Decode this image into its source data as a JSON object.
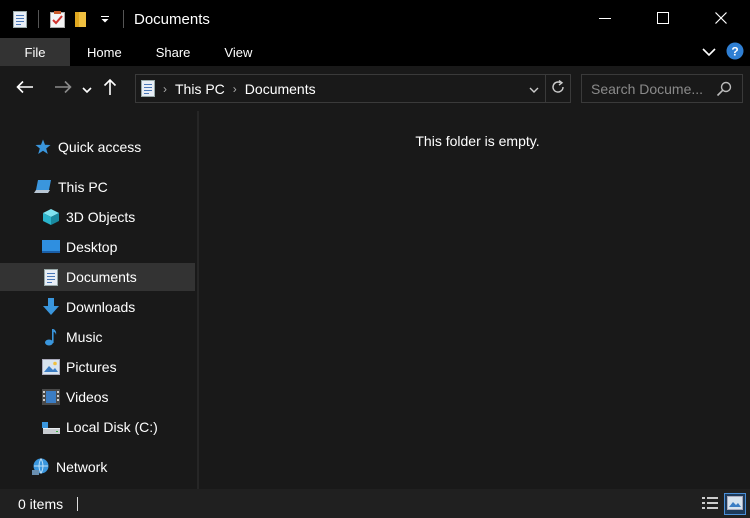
{
  "window": {
    "title": "Documents",
    "minimize_icon": "minimize-icon",
    "maximize_icon": "maximize-icon",
    "close_icon": "close-icon"
  },
  "ribbon": {
    "tabs": [
      {
        "label": "File"
      },
      {
        "label": "Home"
      },
      {
        "label": "Share"
      },
      {
        "label": "View"
      }
    ]
  },
  "address": {
    "segments": [
      "This PC",
      "Documents"
    ]
  },
  "search": {
    "placeholder": "Search Docume..."
  },
  "navpane": {
    "items": [
      {
        "label": "Quick access",
        "icon": "star-icon"
      },
      {
        "label": "This PC",
        "icon": "computer-icon"
      },
      {
        "label": "3D Objects",
        "icon": "cube-icon"
      },
      {
        "label": "Desktop",
        "icon": "desktop-icon"
      },
      {
        "label": "Documents",
        "icon": "document-icon",
        "selected": true
      },
      {
        "label": "Downloads",
        "icon": "download-icon"
      },
      {
        "label": "Music",
        "icon": "music-note-icon"
      },
      {
        "label": "Pictures",
        "icon": "picture-icon"
      },
      {
        "label": "Videos",
        "icon": "video-icon"
      },
      {
        "label": "Local Disk (C:)",
        "icon": "drive-icon"
      },
      {
        "label": "Network",
        "icon": "network-icon"
      }
    ]
  },
  "content": {
    "empty_message": "This folder is empty."
  },
  "status": {
    "item_count": "0 items"
  },
  "colors": {
    "accent": "#3a96dd",
    "selected_bg": "#333333",
    "bg": "#191919"
  }
}
